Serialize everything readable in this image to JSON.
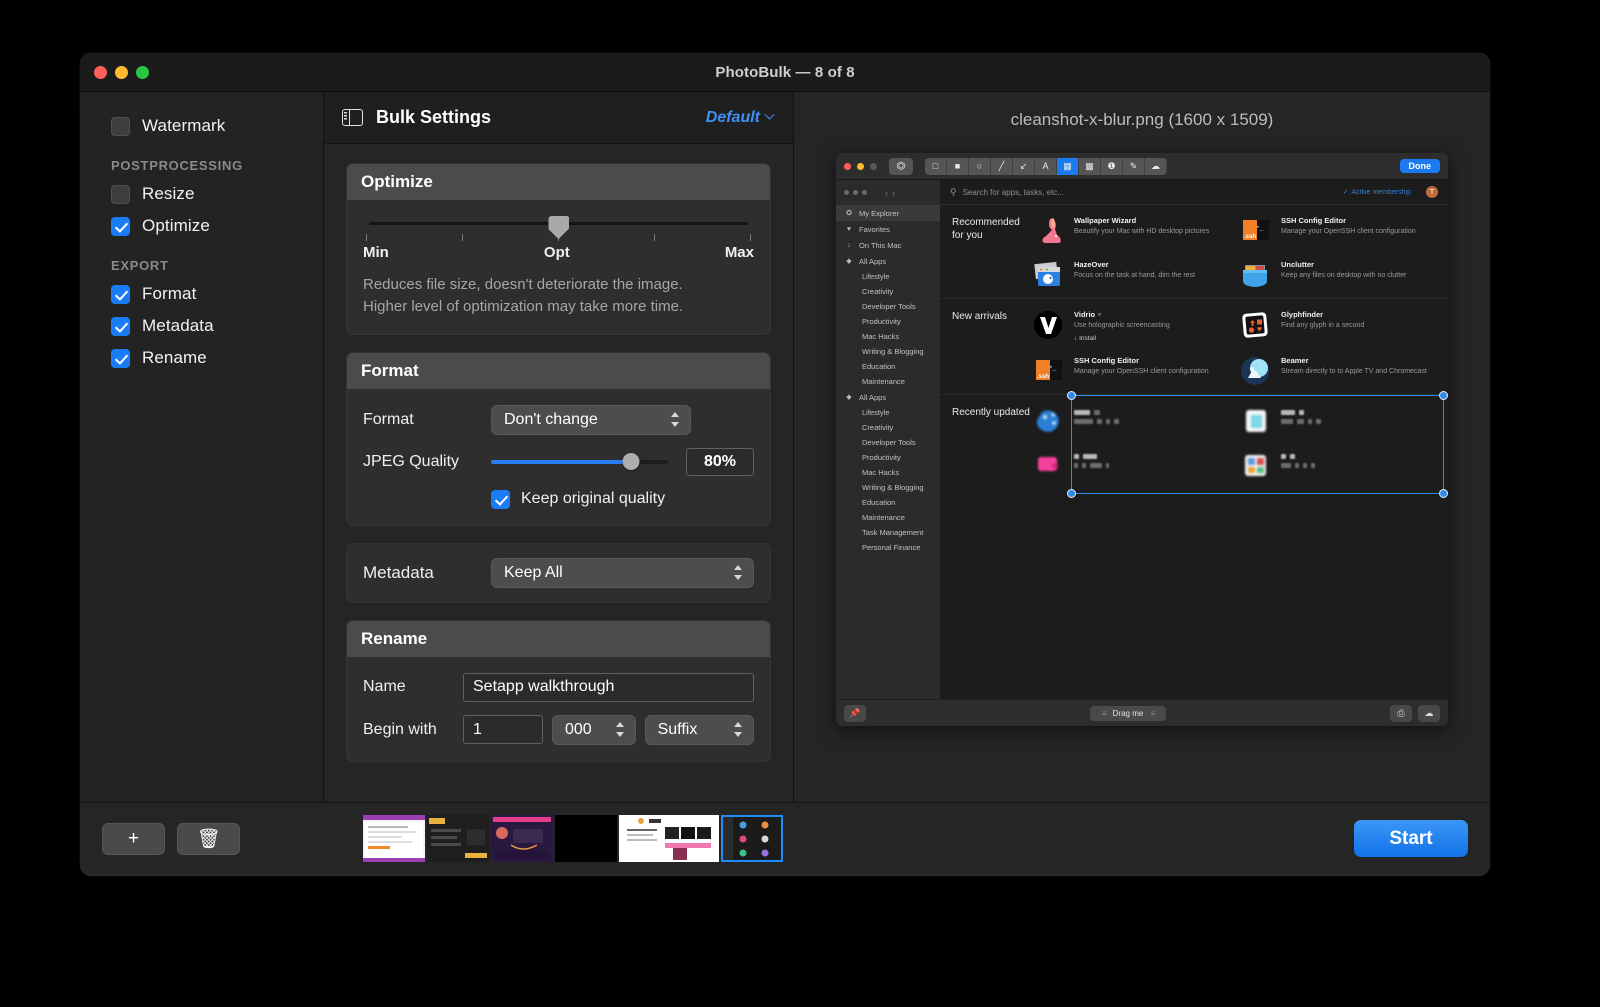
{
  "window": {
    "title": "PhotoBulk — 8 of 8",
    "traffic_lights": [
      "close-red",
      "minimize-yellow",
      "zoom-green"
    ]
  },
  "sidebar": {
    "top_items": [
      {
        "label": "Watermark",
        "checked": false
      }
    ],
    "groups": [
      {
        "heading": "POSTPROCESSING",
        "items": [
          {
            "label": "Resize",
            "checked": false
          },
          {
            "label": "Optimize",
            "checked": true
          }
        ]
      },
      {
        "heading": "EXPORT",
        "items": [
          {
            "label": "Format",
            "checked": true
          },
          {
            "label": "Metadata",
            "checked": true
          },
          {
            "label": "Rename",
            "checked": true
          }
        ]
      }
    ]
  },
  "settings": {
    "title": "Bulk Settings",
    "preset": "Default",
    "optimize": {
      "card_title": "Optimize",
      "min_label": "Min",
      "opt_label": "Opt",
      "max_label": "Max",
      "slider_position_pct": 50,
      "description_line1": "Reduces file size, doesn't deteriorate the image.",
      "description_line2": "Higher level of optimization may take more time."
    },
    "format": {
      "card_title": "Format",
      "format_label": "Format",
      "format_value": "Don't change",
      "quality_label": "JPEG Quality",
      "quality_value": "80%",
      "quality_pct": 79,
      "keep_original_label": "Keep original quality",
      "keep_original_checked": true
    },
    "metadata": {
      "label": "Metadata",
      "value": "Keep All"
    },
    "rename": {
      "card_title": "Rename",
      "name_label": "Name",
      "name_value": "Setapp walkthrough",
      "begin_label": "Begin with",
      "begin_value": "1",
      "padding_value": "000",
      "position_value": "Suffix"
    }
  },
  "preview": {
    "file_title": "cleanshot-x-blur.png (1600 x 1509)",
    "editor": {
      "done_label": "Done",
      "tools": [
        "rect-outline-icon",
        "rect-filled-icon",
        "ellipse-icon",
        "line-icon",
        "arrow-icon",
        "text-icon",
        "pixelate-icon",
        "highlight-icon",
        "counter-icon",
        "pen-icon",
        "blur-icon"
      ],
      "active_tool": "pixelate-icon",
      "crop_tool": "crop-icon"
    },
    "setapp": {
      "search_placeholder": "Search for apps, tasks, etc...",
      "membership": "Active membership",
      "avatar_initial": "T",
      "sidebar": [
        {
          "label": "My Explorer",
          "icon": "explorer-icon",
          "selected": true,
          "sub": false
        },
        {
          "label": "Favorites",
          "icon": "heart-icon",
          "selected": false,
          "sub": false
        },
        {
          "label": "On This Mac",
          "icon": "download-icon",
          "selected": false,
          "sub": false
        },
        {
          "label": "All Apps",
          "icon": "diamond-icon",
          "selected": false,
          "sub": false
        },
        {
          "label": "Lifestyle",
          "icon": "",
          "selected": false,
          "sub": true
        },
        {
          "label": "Creativity",
          "icon": "",
          "selected": false,
          "sub": true
        },
        {
          "label": "Developer Tools",
          "icon": "",
          "selected": false,
          "sub": true
        },
        {
          "label": "Productivity",
          "icon": "",
          "selected": false,
          "sub": true
        },
        {
          "label": "Mac Hacks",
          "icon": "",
          "selected": false,
          "sub": true
        },
        {
          "label": "Writing & Blogging",
          "icon": "",
          "selected": false,
          "sub": true
        },
        {
          "label": "Education",
          "icon": "",
          "selected": false,
          "sub": true
        },
        {
          "label": "Maintenance",
          "icon": "",
          "selected": false,
          "sub": true
        },
        {
          "label": "All Apps",
          "icon": "diamond-icon",
          "selected": false,
          "sub": false
        },
        {
          "label": "Lifestyle",
          "icon": "",
          "selected": false,
          "sub": true
        },
        {
          "label": "Creativity",
          "icon": "",
          "selected": false,
          "sub": true
        },
        {
          "label": "Developer Tools",
          "icon": "",
          "selected": false,
          "sub": true
        },
        {
          "label": "Productivity",
          "icon": "",
          "selected": false,
          "sub": true
        },
        {
          "label": "Mac Hacks",
          "icon": "",
          "selected": false,
          "sub": true
        },
        {
          "label": "Writing & Blogging",
          "icon": "",
          "selected": false,
          "sub": true
        },
        {
          "label": "Education",
          "icon": "",
          "selected": false,
          "sub": true
        },
        {
          "label": "Maintenance",
          "icon": "",
          "selected": false,
          "sub": true
        },
        {
          "label": "Task Management",
          "icon": "",
          "selected": false,
          "sub": true
        },
        {
          "label": "Personal Finance",
          "icon": "",
          "selected": false,
          "sub": true
        }
      ],
      "sections": [
        {
          "title": "Recommended for you",
          "apps": [
            {
              "name": "Wallpaper Wizard",
              "desc": "Beautify your Mac with HD desktop pictures",
              "icon": "rabbit-icon",
              "install": ""
            },
            {
              "name": "SSH Config Editor",
              "desc": "Manage your OpenSSH client configuration",
              "icon": "ssh-folder-icon",
              "install": ""
            },
            {
              "name": "HazeOver",
              "desc": "Focus on the task at hand, dim the rest",
              "icon": "hazeover-icon",
              "install": ""
            },
            {
              "name": "Unclutter",
              "desc": "Keep any files on desktop with no clutter",
              "icon": "pocket-icon",
              "install": ""
            }
          ]
        },
        {
          "title": "New arrivals",
          "apps": [
            {
              "name": "Vidrio",
              "desc": "Use holographic screencasting",
              "icon": "vidrio-v-icon",
              "install": "Install"
            },
            {
              "name": "Glyphfinder",
              "desc": "Find any glyph in a second",
              "icon": "glyphfinder-icon",
              "install": ""
            },
            {
              "name": "SSH Config Editor",
              "desc": "Manage your OpenSSH client configuration",
              "icon": "ssh-folder-icon",
              "install": ""
            },
            {
              "name": "Beamer",
              "desc": "Stream directly to to Apple TV and Chromecast",
              "icon": "beamer-icon",
              "install": ""
            }
          ]
        },
        {
          "title": "Recently updated",
          "blurred": true,
          "apps": [
            {
              "icon": "blue-blob-icon"
            },
            {
              "icon": "white-cyan-icon"
            },
            {
              "icon": "pink-blob-icon"
            },
            {
              "icon": "multicolor-icon"
            }
          ]
        }
      ],
      "bottom": {
        "pin": "pin-icon",
        "drag_label": "Drag me",
        "buttons": [
          "copy-icon",
          "upload-cloud-icon"
        ]
      }
    }
  },
  "bottom_bar": {
    "add_label": "+",
    "add_icon": "plus-icon",
    "delete_icon": "trash-icon",
    "start_label": "Start",
    "thumbnails": [
      {
        "selected": false
      },
      {
        "selected": false
      },
      {
        "selected": false
      },
      {
        "selected": false
      },
      {
        "selected": false
      },
      {
        "selected": true
      }
    ]
  },
  "colors": {
    "accent": "#1a7cf7",
    "link": "#3c92f5",
    "selection": "#2f89e8"
  }
}
